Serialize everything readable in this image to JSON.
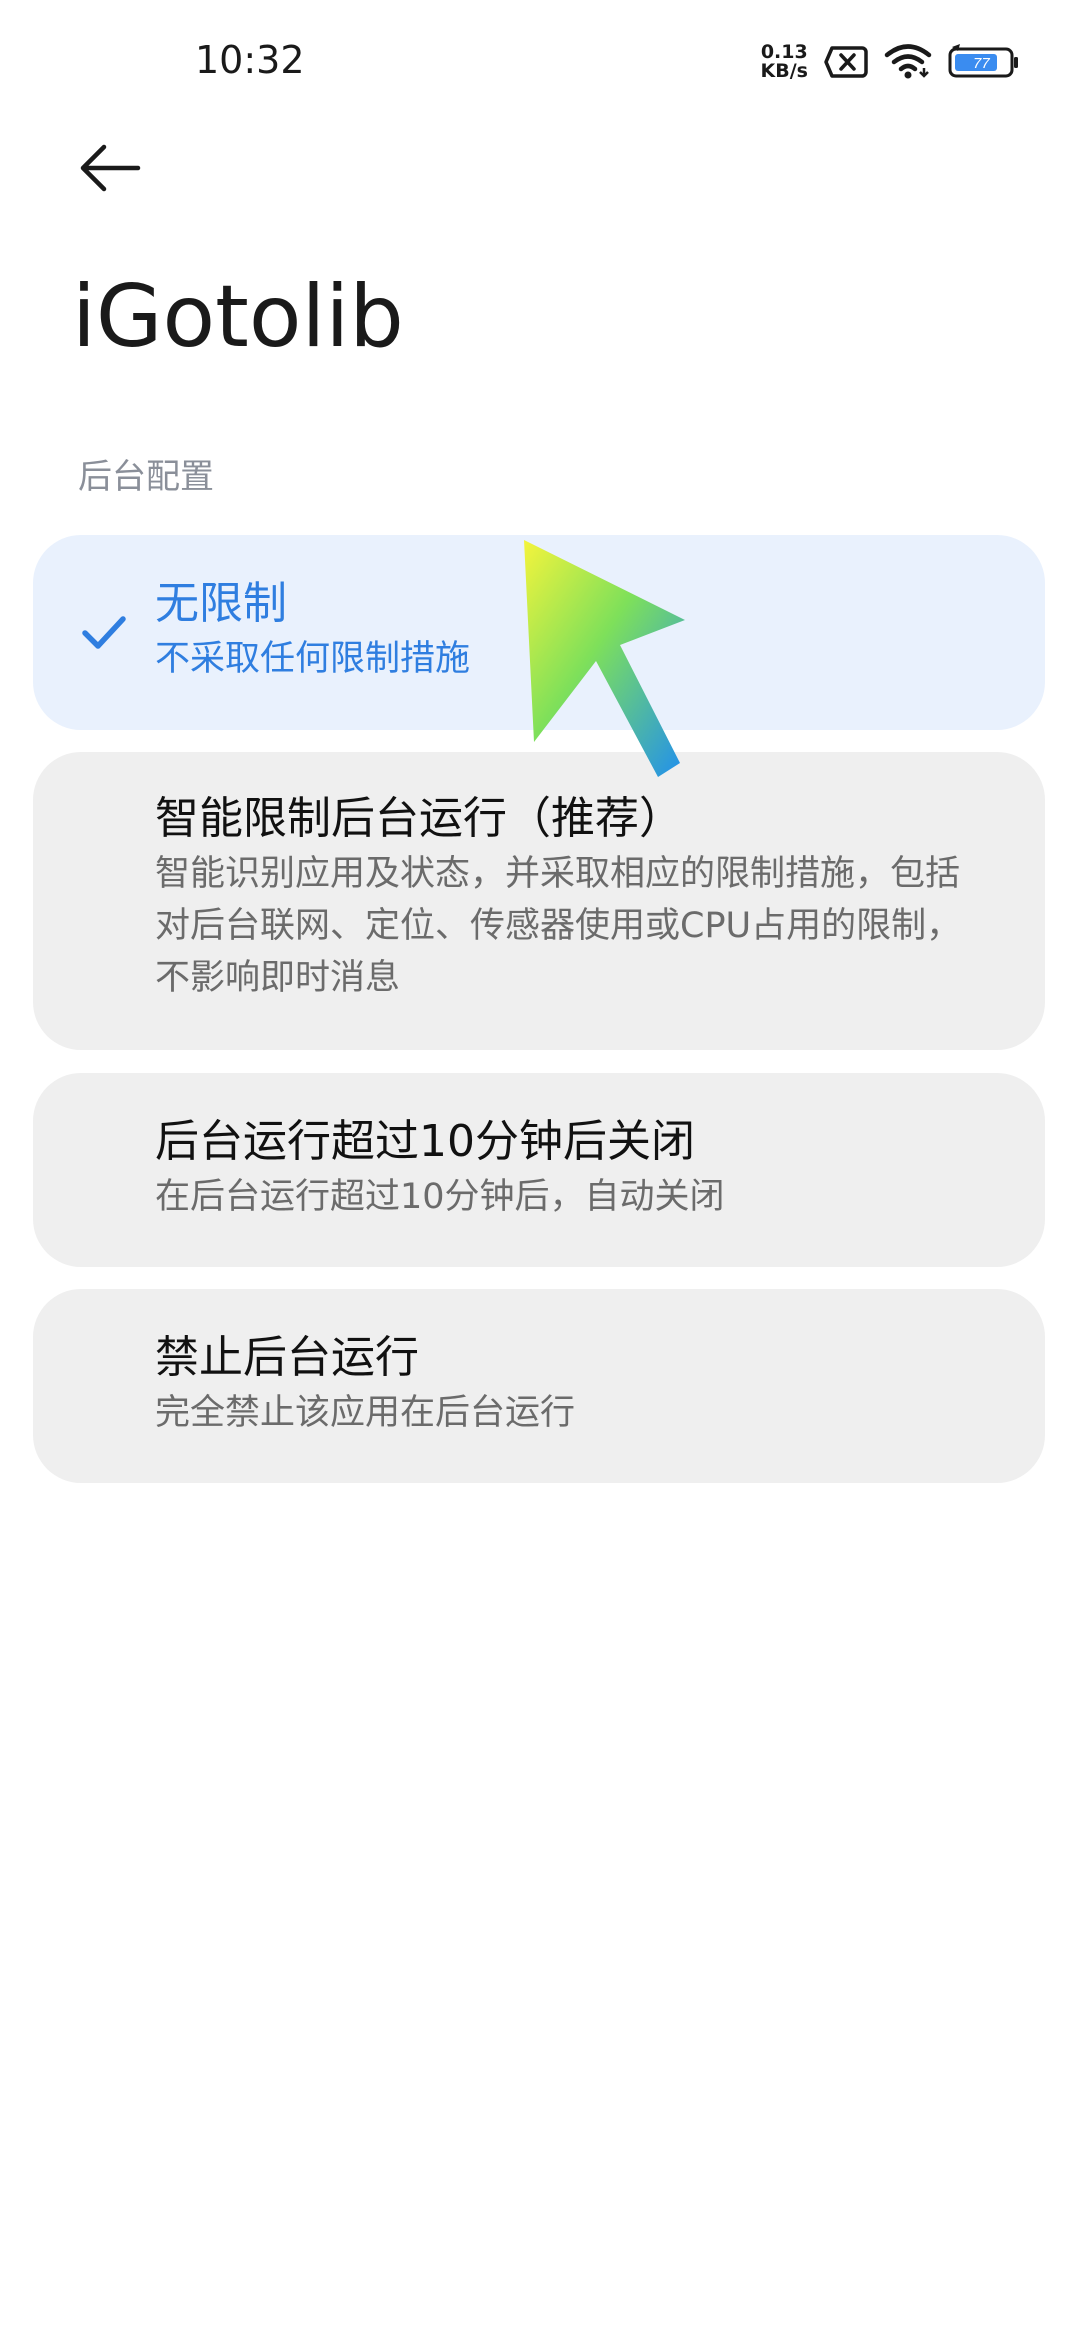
{
  "status_bar": {
    "time": "10:32",
    "net_speed_value": "0.13",
    "net_speed_unit": "KB/s",
    "battery_level": "77",
    "icons": [
      "sim-error-icon",
      "wifi-icon",
      "battery-charging-icon"
    ]
  },
  "header": {
    "back_icon": "arrow-left-icon",
    "title": "iGotolib"
  },
  "section": {
    "label": "后台配置"
  },
  "options": [
    {
      "title": "无限制",
      "description": "不采取任何限制措施",
      "selected": true
    },
    {
      "title": "智能限制后台运行（推荐）",
      "description": "智能识别应用及状态，并采取相应的限制措施，包括对后台联网、定位、传感器使用或CPU占用的限制，不影响即时消息",
      "selected": false
    },
    {
      "title": "后台运行超过10分钟后关闭",
      "description": "在后台运行超过10分钟后，自动关闭",
      "selected": false
    },
    {
      "title": "禁止后台运行",
      "description": "完全禁止该应用在后台运行",
      "selected": false
    }
  ],
  "colors": {
    "accent": "#2f7ee0",
    "selected_bg": "#e9f1fd",
    "card_bg": "#efefef",
    "section_label": "#8a8f99"
  }
}
